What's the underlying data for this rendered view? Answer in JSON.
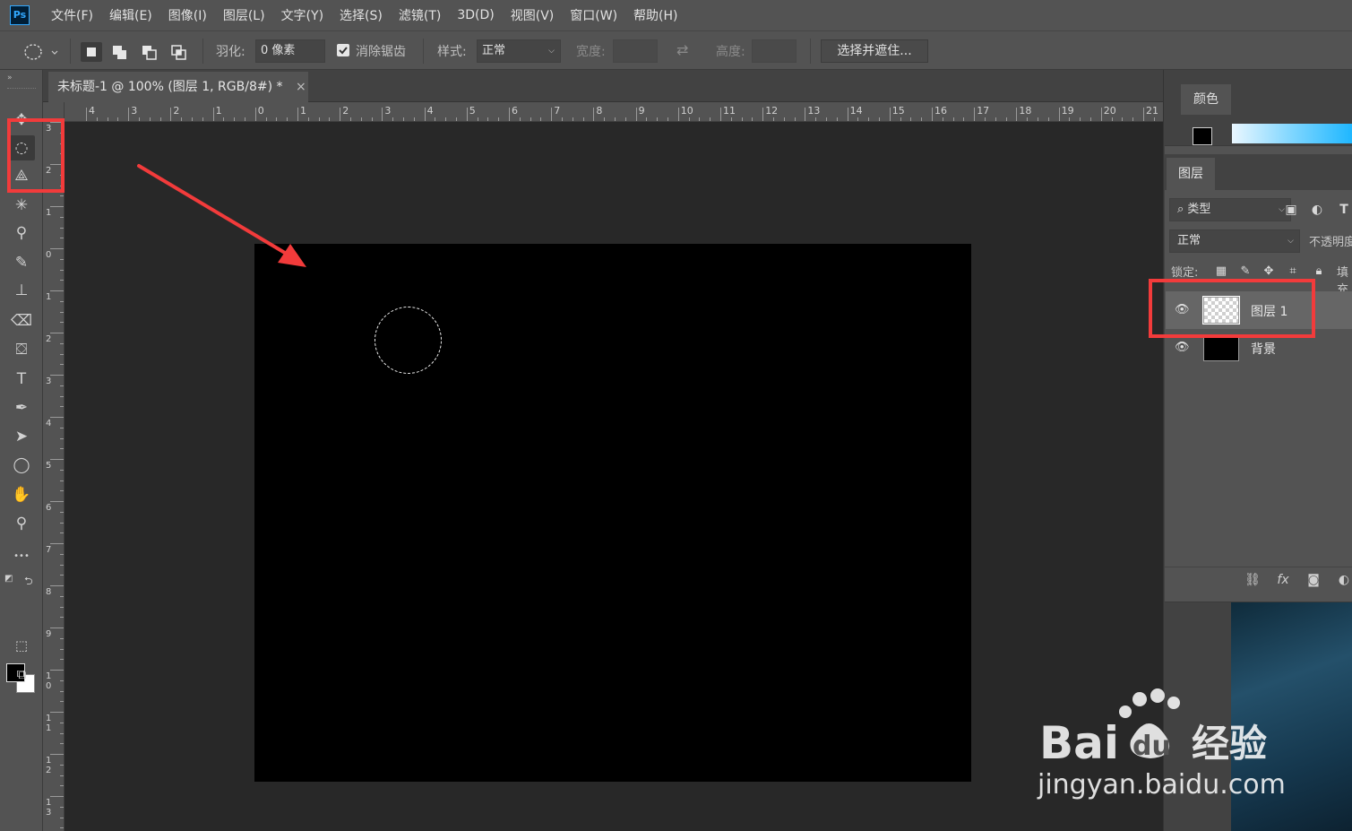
{
  "app": {
    "logo": "Ps"
  },
  "menu": [
    "文件(F)",
    "编辑(E)",
    "图像(I)",
    "图层(L)",
    "文字(Y)",
    "选择(S)",
    "滤镜(T)",
    "3D(D)",
    "视图(V)",
    "窗口(W)",
    "帮助(H)"
  ],
  "options": {
    "feather_label": "羽化:",
    "feather_value": "0 像素",
    "antialias_label": "消除锯齿",
    "antialias_checked": true,
    "style_label": "样式:",
    "style_value": "正常",
    "width_label": "宽度:",
    "height_label": "高度:",
    "select_mask_label": "选择并遮住..."
  },
  "document": {
    "tab_title": "未标题-1 @ 100% (图层 1, RGB/8#) *",
    "close_glyph": "×",
    "canvas_color": "#000000"
  },
  "ruler_h": [
    "4",
    "3",
    "2",
    "1",
    "0",
    "1",
    "2",
    "3",
    "4",
    "5",
    "6",
    "7",
    "8",
    "9",
    "10",
    "11",
    "12",
    "13",
    "14",
    "15",
    "16",
    "17",
    "18",
    "19",
    "20",
    "21"
  ],
  "ruler_v": [
    "3",
    "2",
    "1",
    "0",
    "1",
    "2",
    "3",
    "4",
    "5",
    "6",
    "7",
    "8",
    "9",
    "10",
    "11",
    "12",
    "13"
  ],
  "tools": [
    {
      "name": "move-tool",
      "icon": "move-icon",
      "glyph": "✥"
    },
    {
      "name": "elliptical-marquee-tool",
      "icon": "ellipse-marquee-icon",
      "glyph": "◌"
    },
    {
      "name": "polygonal-lasso-tool",
      "icon": "lasso-icon",
      "glyph": "⟁"
    },
    {
      "name": "magic-wand-tool",
      "icon": "magic-wand-icon",
      "glyph": "✳"
    },
    {
      "name": "eyedropper-tool",
      "icon": "eyedropper-icon",
      "glyph": "⚲"
    },
    {
      "name": "brush-tool",
      "icon": "brush-icon",
      "glyph": "✎"
    },
    {
      "name": "stamp-tool",
      "icon": "stamp-icon",
      "glyph": "⊥"
    },
    {
      "name": "eraser-tool",
      "icon": "eraser-icon",
      "glyph": "⌫"
    },
    {
      "name": "paint-bucket-tool",
      "icon": "bucket-icon",
      "glyph": "⛋"
    },
    {
      "name": "type-tool",
      "icon": "type-icon",
      "glyph": "T"
    },
    {
      "name": "pen-tool",
      "icon": "pen-icon",
      "glyph": "✒"
    },
    {
      "name": "path-selection-tool",
      "icon": "arrow-cursor-icon",
      "glyph": "➤"
    },
    {
      "name": "ellipse-shape-tool",
      "icon": "ellipse-icon",
      "glyph": "◯"
    },
    {
      "name": "hand-tool",
      "icon": "hand-icon",
      "glyph": "✋"
    },
    {
      "name": "zoom-tool",
      "icon": "zoom-icon",
      "glyph": "⚲"
    },
    {
      "name": "more-tools",
      "icon": "more-icon",
      "glyph": "•••"
    }
  ],
  "color_panel": {
    "tab_label": "颜色"
  },
  "layers_panel": {
    "tab_label": "图层",
    "filter_label": "⌕ 类型",
    "blend_mode": "正常",
    "opacity_label": "不透明度",
    "lock_label": "锁定:",
    "fill_label": "填充",
    "layers": [
      {
        "name": "图层 1",
        "visible": true,
        "selected": true,
        "thumb": "transparent"
      },
      {
        "name": "背景",
        "visible": true,
        "selected": false,
        "thumb": "black"
      }
    ]
  },
  "watermark": {
    "text": "jingyan.baidu.com",
    "logo_text": "Bai du 经验"
  },
  "colors": {
    "annotation_red": "#f23b3b",
    "panel_bg": "#535353",
    "workspace_bg": "#282828"
  }
}
